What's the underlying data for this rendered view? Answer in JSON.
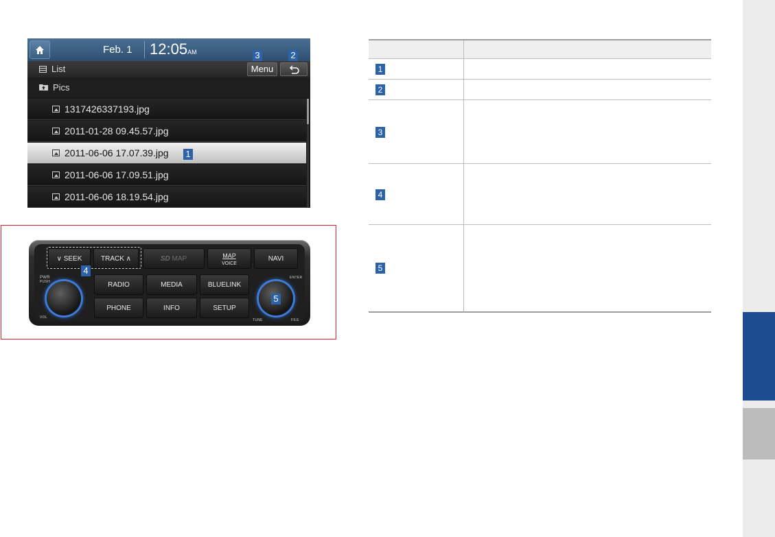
{
  "screen": {
    "date": "Feb.  1",
    "time": "12:05",
    "ampm": "AM",
    "list_label": "List",
    "menu_label": "Menu",
    "folder_label": "Pics",
    "files": [
      "1317426337193.jpg",
      "2011-01-28 09.45.57.jpg",
      "2011-06-06 17.07.39.jpg",
      "2011-06-06 17.09.51.jpg",
      "2011-06-06 18.19.54.jpg"
    ],
    "selected_file_index": 2
  },
  "badges": {
    "b1": "1",
    "b2": "2",
    "b3": "3",
    "b4": "4",
    "b5": "5"
  },
  "console": {
    "seek": "SEEK",
    "track": "TRACK",
    "sd_map": "MAP",
    "sd_prefix": "SD",
    "map": "MAP",
    "voice": "VOICE",
    "navi": "NAVI",
    "radio": "RADIO",
    "media": "MEDIA",
    "bluelink": "BLUELINK",
    "phone": "PHONE",
    "info": "INFO",
    "setup": "SETUP",
    "pwr": "PWR",
    "push": "PUSH",
    "vol": "VOL",
    "enter": "ENTER",
    "tune": "TUNE",
    "file": "FILE"
  },
  "colors": {
    "badge_blue": "#2b62a8",
    "frame_red": "#d8202d",
    "side_tab_blue": "#1d4b91",
    "side_tab_gray": "#bcbcbc"
  }
}
